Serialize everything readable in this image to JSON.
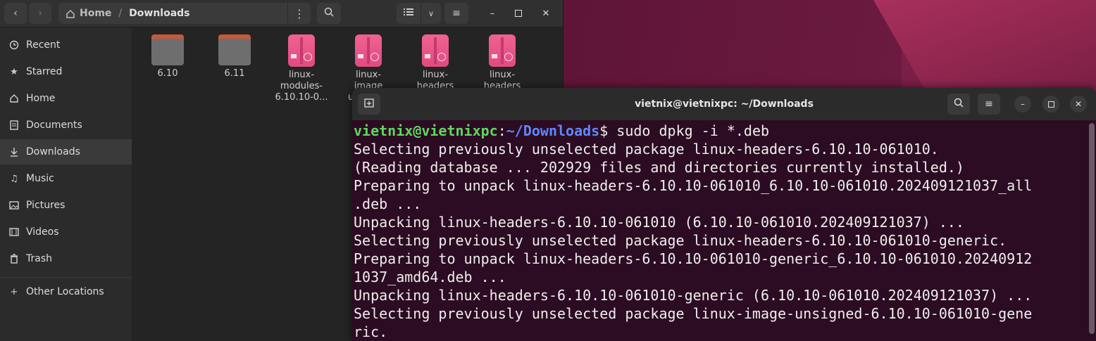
{
  "files": {
    "path": {
      "home": "Home",
      "current": "Downloads"
    },
    "sidebar": [
      {
        "label": "Recent",
        "icon": "clock-icon"
      },
      {
        "label": "Starred",
        "icon": "star-icon"
      },
      {
        "label": "Home",
        "icon": "home-icon"
      },
      {
        "label": "Documents",
        "icon": "document-icon"
      },
      {
        "label": "Downloads",
        "icon": "download-icon",
        "active": true
      },
      {
        "label": "Music",
        "icon": "music-icon"
      },
      {
        "label": "Pictures",
        "icon": "picture-icon"
      },
      {
        "label": "Videos",
        "icon": "video-icon"
      },
      {
        "label": "Trash",
        "icon": "trash-icon"
      }
    ],
    "other_locations": "Other Locations",
    "items": [
      {
        "name": "6.10",
        "type": "folder"
      },
      {
        "name": "6.11",
        "type": "folder"
      },
      {
        "name_lines": [
          "linux-",
          "modules-",
          "6.10.10-0..."
        ],
        "type": "deb"
      },
      {
        "name_lines": [
          "linux-",
          "image",
          "un"
        ],
        "type": "deb"
      },
      {
        "name_lines": [
          "linux-",
          "headers"
        ],
        "type": "deb"
      },
      {
        "name_lines": [
          "linux-",
          "headers"
        ],
        "type": "deb"
      }
    ]
  },
  "terminal": {
    "title": "vietnix@vietnixpc: ~/Downloads",
    "prompt_user": "vietnix@vietnixpc",
    "prompt_colon": ":",
    "prompt_path": "~/Downloads",
    "prompt_dollar": "$ ",
    "command": "sudo dpkg -i *.deb",
    "lines": [
      "Selecting previously unselected package linux-headers-6.10.10-061010.",
      "(Reading database ... 202929 files and directories currently installed.)",
      "Preparing to unpack linux-headers-6.10.10-061010_6.10.10-061010.202409121037_all",
      ".deb ...",
      "Unpacking linux-headers-6.10.10-061010 (6.10.10-061010.202409121037) ...",
      "Selecting previously unselected package linux-headers-6.10.10-061010-generic.",
      "Preparing to unpack linux-headers-6.10.10-061010-generic_6.10.10-061010.20240912",
      "1037_amd64.deb ...",
      "Unpacking linux-headers-6.10.10-061010-generic (6.10.10-061010.202409121037) ...",
      "Selecting previously unselected package linux-image-unsigned-6.10.10-061010-gene",
      "ric."
    ]
  }
}
